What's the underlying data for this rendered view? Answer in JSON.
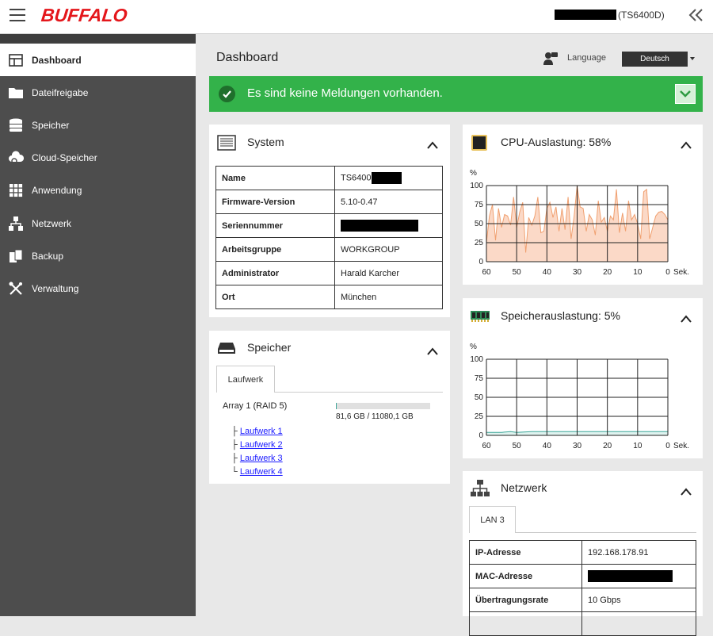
{
  "header": {
    "brand": "BUFFALO",
    "device_suffix": "(TS6400D)"
  },
  "sidebar": {
    "items": [
      {
        "label": "Dashboard",
        "icon": "dashboard-icon",
        "active": true
      },
      {
        "label": "Dateifreigabe",
        "icon": "folder-icon"
      },
      {
        "label": "Speicher",
        "icon": "storage-icon"
      },
      {
        "label": "Cloud-Speicher",
        "icon": "cloud-icon"
      },
      {
        "label": "Anwendung",
        "icon": "grid-icon"
      },
      {
        "label": "Netzwerk",
        "icon": "network-icon"
      },
      {
        "label": "Backup",
        "icon": "backup-icon"
      },
      {
        "label": "Verwaltung",
        "icon": "tools-icon"
      }
    ]
  },
  "main": {
    "title": "Dashboard",
    "language_label": "Language",
    "language_value": "Deutsch",
    "alert": "Es sind keine Meldungen vorhanden.",
    "alert_color": "#33b24a"
  },
  "system": {
    "title": "System",
    "rows": [
      {
        "key": "Name",
        "value": "TS6400",
        "redacted": true
      },
      {
        "key": "Firmware-Version",
        "value": "5.10-0.47"
      },
      {
        "key": "Seriennummer",
        "value": "",
        "redacted": true
      },
      {
        "key": "Arbeitsgruppe",
        "value": "WORKGROUP"
      },
      {
        "key": "Administrator",
        "value": "Harald Karcher"
      },
      {
        "key": "Ort",
        "value": "München"
      }
    ]
  },
  "storage": {
    "title": "Speicher",
    "tab": "Laufwerk",
    "array_label": "Array 1 (RAID 5)",
    "usage_text": "81,6 GB / 11080,1 GB",
    "usage_fraction": 0.0074,
    "drives": [
      "Laufwerk 1",
      "Laufwerk 2",
      "Laufwerk 3",
      "Laufwerk 4"
    ]
  },
  "cpu": {
    "title": "CPU-Auslastung: 58%"
  },
  "memory": {
    "title": "Speicherauslastung: 5%"
  },
  "network": {
    "title": "Netzwerk",
    "tab": "LAN 3",
    "rows": [
      {
        "key": "IP-Adresse",
        "value": "192.168.178.91"
      },
      {
        "key": "MAC-Adresse",
        "value": "",
        "redacted": true
      },
      {
        "key": "Übertragungsrate",
        "value": "10 Gbps"
      }
    ]
  },
  "chart_data": [
    {
      "type": "area",
      "ylabel": "%",
      "xlabel": "Sek.",
      "ylim": [
        0,
        100
      ],
      "xlim": [
        60,
        0
      ],
      "x_ticks": [
        "60",
        "50",
        "40",
        "30",
        "20",
        "10",
        "0"
      ],
      "y_ticks": [
        "0",
        "25",
        "50",
        "75",
        "100"
      ],
      "fill_color": "#fbd9c7",
      "line_color": "#f0a070",
      "x": [
        60,
        59,
        58,
        57,
        56,
        55,
        54,
        53,
        52,
        51,
        50,
        49,
        48,
        47,
        46,
        45,
        44,
        43,
        42,
        41,
        40,
        39,
        38,
        37,
        36,
        35,
        34,
        33,
        32,
        31,
        30,
        29,
        28,
        27,
        26,
        25,
        24,
        23,
        22,
        21,
        20,
        19,
        18,
        17,
        16,
        15,
        14,
        13,
        12,
        11,
        10,
        9,
        8,
        7,
        6,
        5,
        4,
        3,
        2,
        1,
        0
      ],
      "values": [
        25,
        60,
        75,
        28,
        70,
        45,
        62,
        60,
        48,
        85,
        45,
        65,
        78,
        12,
        58,
        48,
        60,
        85,
        38,
        40,
        70,
        78,
        58,
        72,
        40,
        70,
        42,
        85,
        30,
        60,
        100,
        72,
        70,
        40,
        62,
        55,
        35,
        80,
        52,
        58,
        40,
        60,
        55,
        95,
        38,
        64,
        40,
        80,
        55,
        62,
        50,
        30,
        92,
        95,
        30,
        45,
        60,
        65,
        66,
        62,
        55
      ]
    },
    {
      "type": "area",
      "ylabel": "%",
      "xlabel": "Sek.",
      "ylim": [
        0,
        100
      ],
      "xlim": [
        60,
        0
      ],
      "x_ticks": [
        "60",
        "50",
        "40",
        "30",
        "20",
        "10",
        "0"
      ],
      "y_ticks": [
        "0",
        "25",
        "50",
        "75",
        "100"
      ],
      "fill_color": "#dff3ef",
      "line_color": "#3fa89a",
      "x": [
        60,
        55,
        52,
        50,
        45,
        40,
        35,
        30,
        25,
        20,
        15,
        10,
        5,
        0
      ],
      "values": [
        4,
        4,
        5,
        4,
        5,
        5,
        5,
        5,
        5,
        5,
        5,
        5,
        5,
        5
      ]
    }
  ]
}
